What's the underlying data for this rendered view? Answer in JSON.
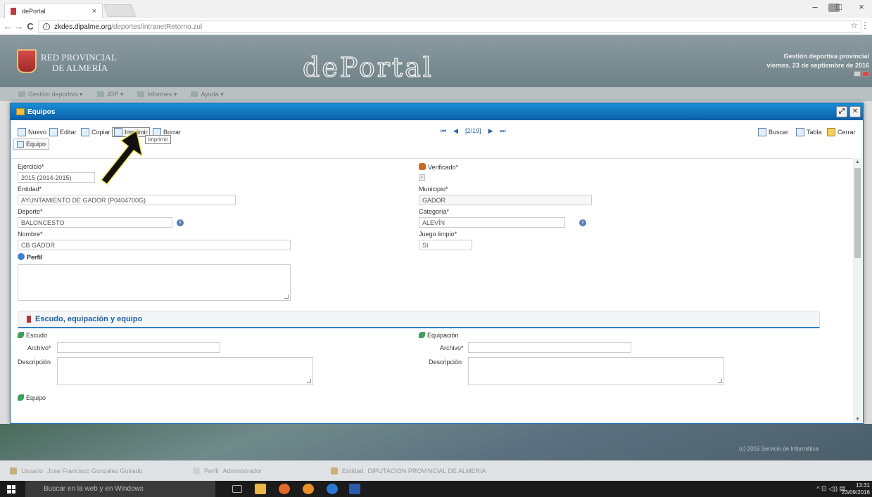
{
  "browser": {
    "tab_title": "dePortal",
    "tab_close": "×",
    "url_host": "zkdes.dipalme.org",
    "url_path": "/deportes/intranetRetorno.zul",
    "back": "←",
    "forward": "→",
    "reload": "C",
    "info": "i",
    "star": "☆",
    "menu": "⋮",
    "minimize": "–",
    "maximize": "□",
    "close": "×"
  },
  "header": {
    "org_line1": "RED PROVINCIAL",
    "org_line2": "DE ALMERÍA",
    "logo": "dePortal",
    "right_line1": "Gestión deportiva provincial",
    "right_line2": "viernes, 23 de septiembre de 2016"
  },
  "menu": [
    {
      "label": "Gestión deportiva ▾"
    },
    {
      "label": "JDP ▾"
    },
    {
      "label": "Informes ▾"
    },
    {
      "label": "Ayuda ▾"
    }
  ],
  "modal": {
    "title": "Equipos",
    "maximize": "⤢",
    "close": "✕",
    "toolbar": {
      "nuevo": "Nuevo",
      "editar": "Editar",
      "copiar": "Copiar",
      "imprimir": "Imprimir",
      "borrar": "Borrar",
      "buscar": "Buscar",
      "tabla": "Tabla",
      "cerrar": "Cerrar"
    },
    "tooltip": "Imprimir",
    "pager": {
      "first": "⏮",
      "prev": "◀",
      "text": "[2/19]",
      "next": "▶",
      "last": "⏭"
    },
    "tab": "Equipo",
    "form": {
      "ejercicio_label": "Ejercicio*",
      "ejercicio_value": "2015 (2014-2015)",
      "entidad_label": "Entidad*",
      "entidad_value": "AYUNTAMIENTO DE GADOR (P0404700G)",
      "deporte_label": "Deporte*",
      "deporte_value": "BALONCESTO",
      "nombre_label": "Nombre*",
      "nombre_value": "CB GÁDOR",
      "perfil_label": "Perfil",
      "verificado_label": "Verificado*",
      "verificado_check": "✓",
      "municipio_label": "Municipio*",
      "municipio_value": "GADOR",
      "categoria_label": "Categoría*",
      "categoria_value": "ALEVÍN",
      "juego_label": "Juego limpio*",
      "juego_value": "Sí",
      "info": "i"
    },
    "section": {
      "title": "Escudo, equipación y equipo",
      "escudo": "Escudo",
      "equipacion": "Equipación",
      "archivo_label": "Archivo*",
      "descripcion_label": "Descripción",
      "equipo": "Equipo"
    }
  },
  "footer": {
    "copyright": "(c) 2016 Servicio de Informática",
    "usuario_label": "Usuario",
    "usuario_value": "Jose Francisco Gonzalez Guirado",
    "perfil_label": "Perfil",
    "perfil_value": "Administrador",
    "entidad_label": "Entidad",
    "entidad_value": "DIPUTACION PROVINCIAL DE ALMERIA"
  },
  "taskbar": {
    "search_placeholder": "Buscar en la web y en Windows",
    "time": "13:31",
    "date": "23/09/2016",
    "tray": "^  ⊡  ◁))  ▤"
  },
  "colors": {
    "accent": "#1a8ed8",
    "section_title": "#1f63a8",
    "header_bg": "#7f9196"
  }
}
